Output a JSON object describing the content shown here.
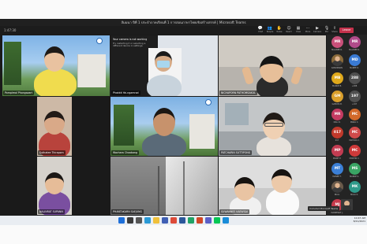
{
  "window": {
    "title": "สัมมนา ปีที่ 1 ประจำภาคเรียนที่ 1 การสอนภาษาไทยเชิงสร้างสรรค์ | Microsoft Teams"
  },
  "toolbar": {
    "timer": "1:47:30",
    "buttons": [
      {
        "name": "chat",
        "glyph": "💬",
        "label": "Chat"
      },
      {
        "name": "people",
        "glyph": "👥",
        "label": "People"
      },
      {
        "name": "raise",
        "glyph": "✋",
        "label": "Raise"
      },
      {
        "name": "react",
        "glyph": "☺",
        "label": "React"
      },
      {
        "name": "view",
        "glyph": "▦",
        "label": "View"
      },
      {
        "name": "more",
        "glyph": "⋯",
        "label": "More"
      },
      {
        "name": "camera",
        "glyph": "▶",
        "label": "Camera"
      },
      {
        "name": "mic",
        "glyph": "🎙",
        "label": "Mic"
      },
      {
        "name": "share",
        "glyph": "⇪",
        "label": "Share"
      }
    ],
    "leave_label": "Leave"
  },
  "tiles": [
    {
      "id": "t1",
      "name": "Pornpimol Phongsaart"
    },
    {
      "id": "t2",
      "name": "Phakkit Yai-ngamrod"
    },
    {
      "id": "t3",
      "name": "NICHAPORN PATHOMSAKUL"
    },
    {
      "id": "t4",
      "name": "Suthatee Thiraporn"
    },
    {
      "id": "t5",
      "name": "Wachara Chaobang"
    },
    {
      "id": "t6",
      "name": "PATCHARIN SUTTIPONG"
    },
    {
      "id": "t7",
      "name": "NALINRAT SUPANIK"
    },
    {
      "id": "t8",
      "name": "PHANTAKARN SAEJUNG"
    },
    {
      "id": "t9",
      "name": "SUWANNEE KAEWSAI"
    }
  ],
  "share_notice": {
    "title": "Your camera is not working",
    "body": "Try restarting it or selecting a different device in settings."
  },
  "participants": [
    {
      "initials": "MR",
      "color": "#c9507a",
      "name": "MALINEE R."
    },
    {
      "initials": "MR",
      "color": "#b04b8a",
      "name": "MALINEE R."
    },
    {
      "initials": "",
      "color": "#8a6a3a",
      "name": "KANOKWAN"
    },
    {
      "initials": "MD",
      "color": "#3a7bd5",
      "name": "MANEE D."
    },
    {
      "initials": "MB",
      "color": "#e0a91b",
      "name": "MANOP B."
    },
    {
      "initials": "288",
      "color": "#505050",
      "name": "+288"
    },
    {
      "initials": "GM",
      "color": "#d99f2b",
      "name": "GAMON M."
    },
    {
      "initials": "197",
      "color": "#505050",
      "name": "+197"
    },
    {
      "initials": "MR",
      "color": "#c43b62",
      "name": "MALI R."
    },
    {
      "initials": "MC",
      "color": "#d2692a",
      "name": "MANA C."
    },
    {
      "initials": "017",
      "color": "#c0392b",
      "name": "017"
    },
    {
      "initials": "MC",
      "color": "#d04a4a",
      "name": "MAYURA C."
    },
    {
      "initials": "MP",
      "color": "#c23c52",
      "name": "MANIT P."
    },
    {
      "initials": "MC",
      "color": "#cf3a3a",
      "name": "MONTRI C."
    },
    {
      "initials": "MT",
      "color": "#3b7fd6",
      "name": "MANEE T."
    },
    {
      "initials": "MS",
      "color": "#3aa564",
      "name": "MANOP S."
    },
    {
      "initials": "",
      "color": "#6a5a4a",
      "name": "NUAL"
    },
    {
      "initials": "MK",
      "color": "#2f9a8a",
      "name": "MALA K."
    },
    {
      "initials": "MJ",
      "color": "#c73a4c",
      "name": "MANEERAT J."
    }
  ],
  "self_view": {
    "label": "Unmuted Microsoft Teams"
  },
  "taskbar": {
    "time": "10:47 AM",
    "date": "8/21/2021",
    "apps": [
      {
        "name": "start",
        "color": "#1e6fd9"
      },
      {
        "name": "search",
        "color": "#3b3b3b"
      },
      {
        "name": "taskview",
        "color": "#555555"
      },
      {
        "name": "edge",
        "color": "#2b9ad6"
      },
      {
        "name": "explorer",
        "color": "#f0c03a"
      },
      {
        "name": "store",
        "color": "#3f5fb4"
      },
      {
        "name": "chrome",
        "color": "#dd4b39"
      },
      {
        "name": "word",
        "color": "#2b579a"
      },
      {
        "name": "excel",
        "color": "#21a366"
      },
      {
        "name": "powerpoint",
        "color": "#d24726"
      },
      {
        "name": "teams",
        "color": "#5b5fc7"
      },
      {
        "name": "line",
        "color": "#06c755"
      },
      {
        "name": "photos",
        "color": "#1a8cd8"
      }
    ]
  }
}
